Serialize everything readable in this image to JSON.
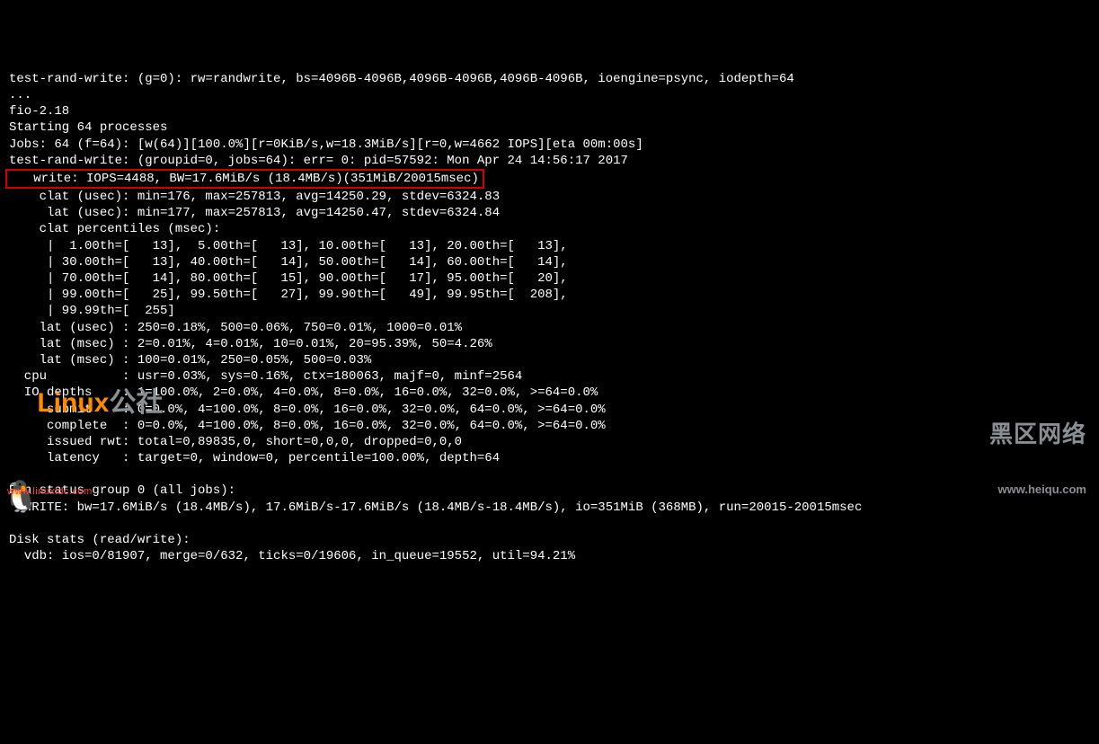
{
  "lines": {
    "l1": "test-rand-write: (g=0): rw=randwrite, bs=4096B-4096B,4096B-4096B,4096B-4096B, ioengine=psync, iodepth=64",
    "l2": "...",
    "l3": "fio-2.18",
    "l4": "Starting 64 processes",
    "l5": "Jobs: 64 (f=64): [w(64)][100.0%][r=0KiB/s,w=18.3MiB/s][r=0,w=4662 IOPS][eta 00m:00s]",
    "l6": "test-rand-write: (groupid=0, jobs=64): err= 0: pid=57592: Mon Apr 24 14:56:17 2017",
    "l7": "   write: IOPS=4488, BW=17.6MiB/s (18.4MB/s)(351MiB/20015msec)",
    "l8": "    clat (usec): min=176, max=257813, avg=14250.29, stdev=6324.83",
    "l9": "     lat (usec): min=177, max=257813, avg=14250.47, stdev=6324.84",
    "l10": "    clat percentiles (msec):",
    "l11": "     |  1.00th=[   13],  5.00th=[   13], 10.00th=[   13], 20.00th=[   13],",
    "l12": "     | 30.00th=[   13], 40.00th=[   14], 50.00th=[   14], 60.00th=[   14],",
    "l13": "     | 70.00th=[   14], 80.00th=[   15], 90.00th=[   17], 95.00th=[   20],",
    "l14": "     | 99.00th=[   25], 99.50th=[   27], 99.90th=[   49], 99.95th=[  208],",
    "l15": "     | 99.99th=[  255]",
    "l16": "    lat (usec) : 250=0.18%, 500=0.06%, 750=0.01%, 1000=0.01%",
    "l17": "    lat (msec) : 2=0.01%, 4=0.01%, 10=0.01%, 20=95.39%, 50=4.26%",
    "l18": "    lat (msec) : 100=0.01%, 250=0.05%, 500=0.03%",
    "l19": "  cpu          : usr=0.03%, sys=0.16%, ctx=180063, majf=0, minf=2564",
    "l20": "  IO depths    : 1=100.0%, 2=0.0%, 4=0.0%, 8=0.0%, 16=0.0%, 32=0.0%, >=64=0.0%",
    "l21": "     submit    : 0=0.0%, 4=100.0%, 8=0.0%, 16=0.0%, 32=0.0%, 64=0.0%, >=64=0.0%",
    "l22": "     complete  : 0=0.0%, 4=100.0%, 8=0.0%, 16=0.0%, 32=0.0%, 64=0.0%, >=64=0.0%",
    "l23": "     issued rwt: total=0,89835,0, short=0,0,0, dropped=0,0,0",
    "l24": "     latency   : target=0, window=0, percentile=100.00%, depth=64",
    "l25": "",
    "l26": "Run status group 0 (all jobs):",
    "l27": "  WRITE: bw=17.6MiB/s (18.4MB/s), 17.6MiB/s-17.6MiB/s (18.4MB/s-18.4MB/s), io=351MiB (368MB), run=20015-20015msec",
    "l28": "",
    "l29": "Disk stats (read/write):",
    "l30": "  vdb: ios=0/81907, merge=0/632, ticks=0/19606, in_queue=19552, util=94.21%"
  },
  "watermark": {
    "left_brand_part1": "Linux",
    "left_brand_part2": "公社",
    "left_tag": "www.linuxidc.com",
    "right_big": "黑区网络",
    "right_url": "www.heiqu.com"
  }
}
